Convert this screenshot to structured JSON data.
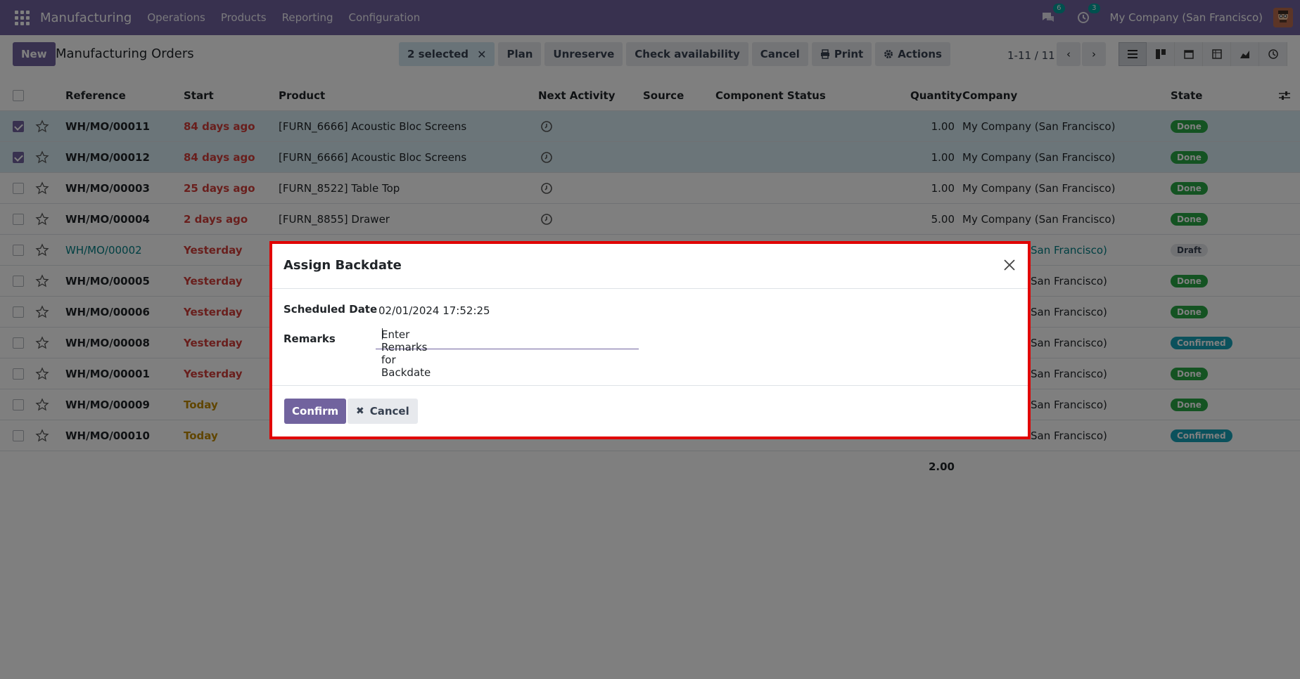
{
  "nav": {
    "app_title": "Manufacturing",
    "menu": [
      "Operations",
      "Products",
      "Reporting",
      "Configuration"
    ],
    "messages_count": "6",
    "activities_count": "3",
    "company": "My Company (San Francisco)",
    "brand_color": "#71639e"
  },
  "control_panel": {
    "new_label": "New",
    "title": "Manufacturing Orders",
    "selected_label": "2 selected",
    "actions": [
      "Plan",
      "Unreserve",
      "Check availability",
      "Cancel",
      "Print",
      "Actions"
    ],
    "pager": "1-11 / 11"
  },
  "columns": [
    "Reference",
    "Start",
    "Product",
    "Next Activity",
    "Source",
    "Component Status",
    "Quantity",
    "Company",
    "State"
  ],
  "rows": [
    {
      "ref": "WH/MO/00011",
      "start": "84 days ago",
      "product": "[FURN_6666] Acoustic Bloc Screens",
      "qty": "1.00",
      "company": "My Company (San Francisco)",
      "state": "Done",
      "checked": true
    },
    {
      "ref": "WH/MO/00012",
      "start": "84 days ago",
      "product": "[FURN_6666] Acoustic Bloc Screens",
      "qty": "1.00",
      "company": "My Company (San Francisco)",
      "state": "Done",
      "checked": true
    },
    {
      "ref": "WH/MO/00003",
      "start": "25 days ago",
      "product": "[FURN_8522] Table Top",
      "qty": "1.00",
      "company": "My Company (San Francisco)",
      "state": "Done",
      "checked": false
    },
    {
      "ref": "WH/MO/00004",
      "start": "2 days ago",
      "product": "[FURN_8855] Drawer",
      "qty": "5.00",
      "company": "My Company (San Francisco)",
      "state": "Done",
      "checked": false
    },
    {
      "ref": "WH/MO/00002",
      "start": "Yesterday",
      "product": "",
      "qty": "",
      "company": "San Francisco)",
      "state": "Draft",
      "checked": false
    },
    {
      "ref": "WH/MO/00005",
      "start": "Yesterday",
      "product": "",
      "qty": "",
      "company": "San Francisco)",
      "state": "Done",
      "checked": false
    },
    {
      "ref": "WH/MO/00006",
      "start": "Yesterday",
      "product": "",
      "qty": "",
      "company": "San Francisco)",
      "state": "Done",
      "checked": false
    },
    {
      "ref": "WH/MO/00008",
      "start": "Yesterday",
      "product": "",
      "qty": "",
      "company": "San Francisco)",
      "state": "Confirmed",
      "checked": false
    },
    {
      "ref": "WH/MO/00001",
      "start": "Yesterday",
      "product": "",
      "qty": "",
      "company": "San Francisco)",
      "state": "Done",
      "checked": false
    },
    {
      "ref": "WH/MO/00009",
      "start": "Today",
      "product": "",
      "qty": "",
      "company": "San Francisco)",
      "state": "Done",
      "checked": false
    },
    {
      "ref": "WH/MO/00010",
      "start": "Today",
      "product": "",
      "qty": "",
      "company": "San Francisco)",
      "state": "Confirmed",
      "checked": false
    }
  ],
  "total_qty": "2.00",
  "dialog": {
    "title": "Assign Backdate",
    "scheduled_label": "Scheduled Date",
    "scheduled_value": "02/01/2024 17:52:25",
    "remarks_label": "Remarks",
    "remarks_value": "Enter Remarks for Backdate",
    "confirm_label": "Confirm",
    "cancel_label": "Cancel"
  }
}
